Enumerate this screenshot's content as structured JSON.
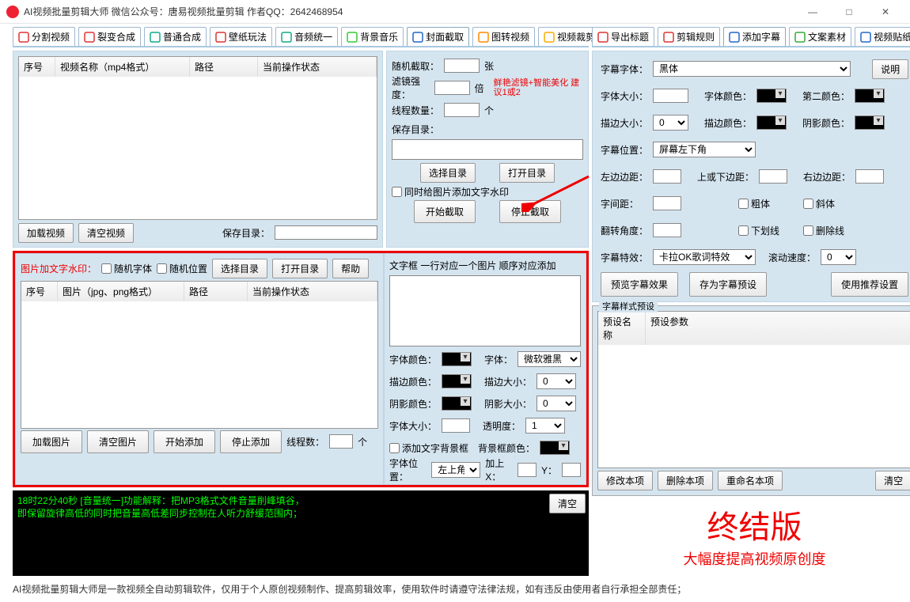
{
  "titlebar": {
    "title": "AI视频批量剪辑大师   微信公众号：唐易视频批量剪辑   作者QQ：2642468954"
  },
  "tabs_left": [
    {
      "label": "分割视频",
      "icon": "split",
      "color": "#d33"
    },
    {
      "label": "裂变合成",
      "icon": "merge",
      "color": "#d33"
    },
    {
      "label": "普通合成",
      "icon": "play",
      "color": "#1a8"
    },
    {
      "label": "壁纸玩法",
      "icon": "wall",
      "color": "#d33"
    },
    {
      "label": "音频统一",
      "icon": "audio",
      "color": "#1a8"
    },
    {
      "label": "背景音乐",
      "icon": "music",
      "color": "#3c3"
    },
    {
      "label": "封面截取",
      "icon": "crop",
      "color": "#26c",
      "active": true
    },
    {
      "label": "图转视频",
      "icon": "img2vid",
      "color": "#f80"
    },
    {
      "label": "视频裁剪",
      "icon": "cut",
      "color": "#fa0"
    }
  ],
  "tabs_right": [
    {
      "label": "导出标题",
      "icon": "export",
      "color": "#d33"
    },
    {
      "label": "剪辑规则",
      "icon": "rules",
      "color": "#d33"
    },
    {
      "label": "添加字幕",
      "icon": "subtitle",
      "color": "#26c",
      "active": true
    },
    {
      "label": "文案素材",
      "icon": "draft",
      "color": "#3a3"
    },
    {
      "label": "视频贴纸",
      "icon": "sticker",
      "color": "#26c"
    }
  ],
  "cover": {
    "cols": {
      "id": "序号",
      "name": "视频名称（mp4格式）",
      "path": "路径",
      "status": "当前操作状态"
    },
    "btn_load": "加载视频",
    "btn_clear": "清空视频",
    "save_dir": "保存目录：",
    "rand_capture": "随机截取：",
    "unit_sheet": "张",
    "filter_strength": "滤镜强度：",
    "unit_mul": "倍",
    "filter_hint": "鲜艳滤镜+智能美化 建议1或2",
    "threads": "线程数量：",
    "unit_pcs": "个",
    "save_dir2": "保存目录：",
    "btn_sel_dir": "选择目录",
    "btn_open_dir": "打开目录",
    "cb_watermark": "同时给图片添加文字水印",
    "btn_start": "开始截取",
    "btn_stop": "停止截取"
  },
  "wm": {
    "title": "图片加文字水印：",
    "cb_randfont": "随机字体",
    "cb_randpos": "随机位置",
    "btn_sel": "选择目录",
    "btn_open": "打开目录",
    "btn_help": "帮助",
    "cols": {
      "id": "序号",
      "img": "图片（jpg、png格式）",
      "path": "路径",
      "status": "当前操作状态"
    },
    "btn_add": "加载图片",
    "btn_clear": "清空图片",
    "btn_start": "开始添加",
    "btn_stop": "停止添加",
    "threads": "线程数：",
    "unit": "个",
    "textbox_label": "文字框 一行对应一个图片 顺序对应添加",
    "font_color": "字体颜色：",
    "font": "字体：",
    "font_value": "微软雅黑",
    "stroke_color": "描边颜色：",
    "stroke_size": "描边大小：",
    "stroke_val": "0",
    "shadow_color": "阴影颜色：",
    "shadow_size": "阴影大小：",
    "shadow_val": "0",
    "font_size": "字体大小：",
    "opacity": "透明度：",
    "opacity_val": "1",
    "bg_box": "添加文字背景框",
    "bg_color": "背景框颜色：",
    "pos": "字体位置：",
    "pos_val": "左上角",
    "addX": "加上X：",
    "Y": "Y："
  },
  "sub": {
    "instruct": "说明",
    "font_family": "字幕字体：",
    "family_val": "黑体",
    "font_size": "字体大小：",
    "font_color": "字体颜色：",
    "sec_color": "第二颜色：",
    "stroke_size": "描边大小：",
    "stroke_val": "0",
    "stroke_color": "描边颜色：",
    "shadow_color": "阴影颜色：",
    "position": "字幕位置：",
    "pos_val": "屏幕左下角",
    "left": "左边边距：",
    "topbot": "上或下边距：",
    "right": "右边边距：",
    "spacing": "字间距：",
    "cb_bold": "粗体",
    "cb_italic": "斜体",
    "angle": "翻转角度：",
    "cb_underline": "下划线",
    "cb_strike": "删除线",
    "effect": "字幕特效：",
    "effect_val": "卡拉OK歌词特效",
    "scroll": "滚动速度：",
    "scroll_val": "0",
    "btn_preview": "预览字幕效果",
    "btn_save_preset": "存为字幕预设",
    "btn_recommend": "使用推荐设置",
    "preset_group": "字幕样式预设",
    "col_name": "预设名称",
    "col_params": "预设参数",
    "btn_edit": "修改本项",
    "btn_del": "删除本项",
    "btn_rename": "重命名本项",
    "btn_clear": "清空"
  },
  "log": {
    "line1": "18时22分40秒 [音量统一]功能解释：把MP3格式文件音量削峰填谷，",
    "line2": "       即保留旋律高低的同时把音量高低差同步控制在人听力舒缓范围内；",
    "btn": "清空"
  },
  "promo": {
    "big": "终结版",
    "small": "大幅度提高视频原创度"
  },
  "footer": "AI视频批量剪辑大师是一款视频全自动剪辑软件，仅用于个人原创视频制作、提高剪辑效率，使用软件时请遵守法律法规，如有违反由使用者自行承担全部责任；"
}
